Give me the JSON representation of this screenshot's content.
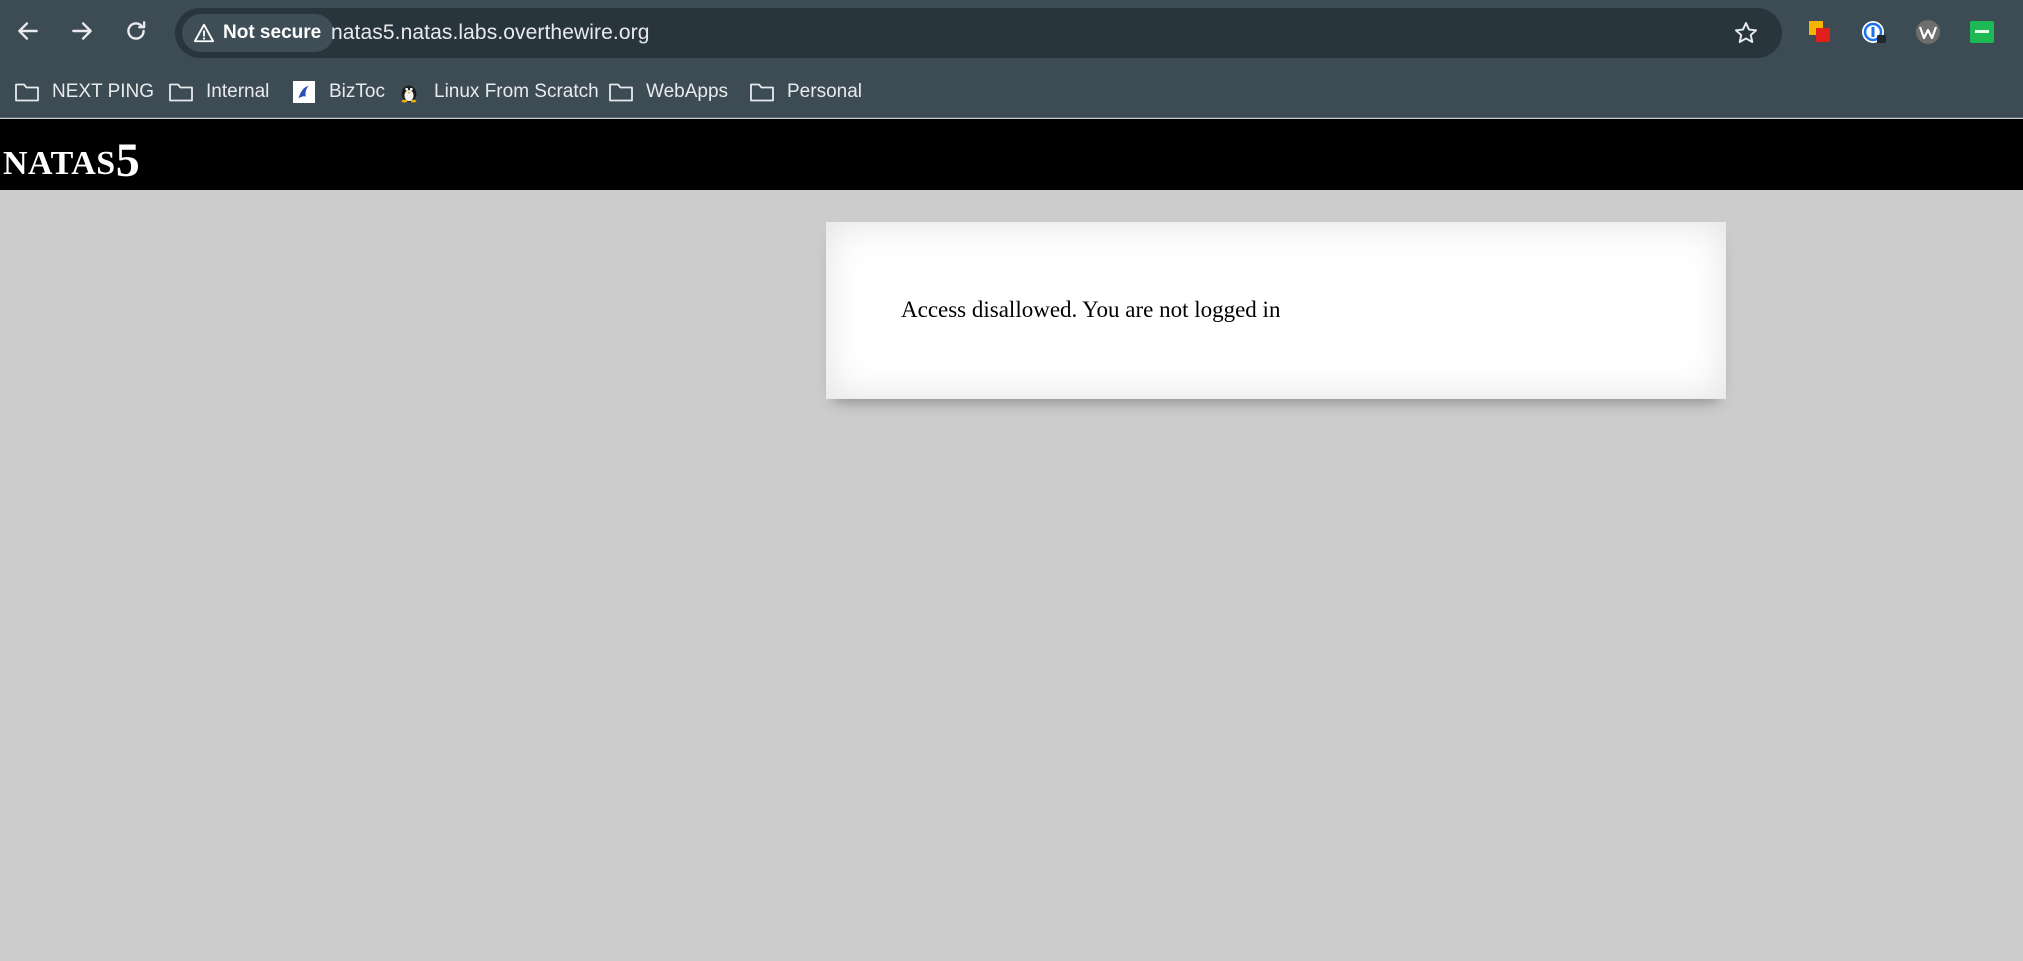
{
  "browser": {
    "security_label": "Not secure",
    "url": "natas5.natas.labs.overthewire.org",
    "icons": {
      "back": "back-arrow-icon",
      "forward": "forward-arrow-icon",
      "reload": "reload-icon",
      "warning": "warning-triangle-icon",
      "bookmark": "star-icon"
    },
    "extensions": [
      "extension-icon",
      "extension-icon",
      "extension-icon",
      "extension-icon"
    ]
  },
  "bookmarks": [
    {
      "label": "NEXT PING",
      "icon": "folder-icon"
    },
    {
      "label": "Internal",
      "icon": "folder-icon"
    },
    {
      "label": "BizToc",
      "icon": "site-favicon"
    },
    {
      "label": "Linux From Scratch",
      "icon": "site-favicon"
    },
    {
      "label": "WebApps",
      "icon": "folder-icon"
    },
    {
      "label": "Personal",
      "icon": "folder-icon"
    }
  ],
  "page": {
    "title_prefix": "NATAS",
    "title_number": "5",
    "message": "Access disallowed. You are not logged in"
  },
  "colors": {
    "toolbar": "#3c4b54",
    "omnibox": "#28353c",
    "page_background": "#cccccc",
    "header": "#000000",
    "content_box": "#ffffff"
  }
}
